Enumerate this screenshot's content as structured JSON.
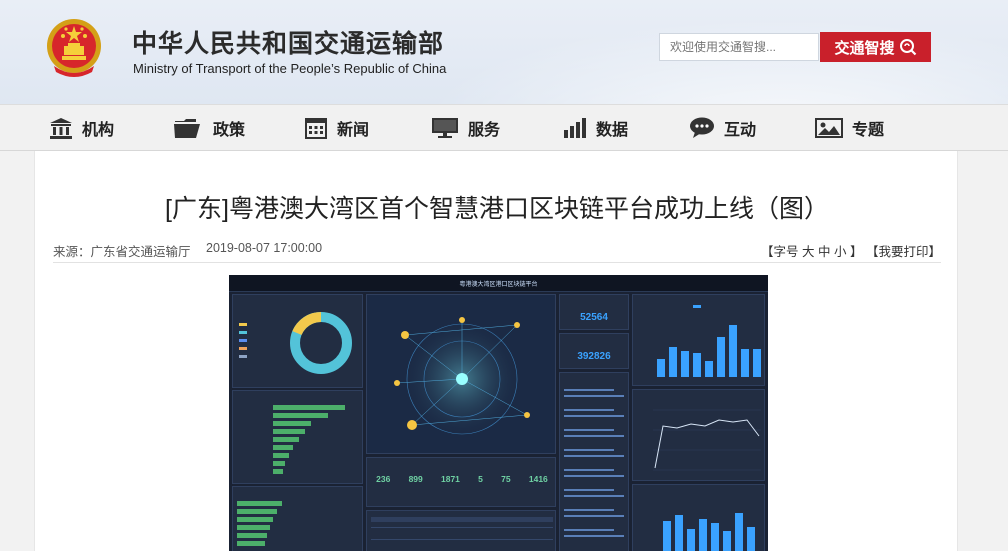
{
  "header": {
    "site_title_cn": "中华人民共和国交通运输部",
    "site_title_en": "Ministry of Transport of the People’s Republic of China",
    "search_placeholder": "欢迎使用交通智搜...",
    "search_button": "交通智搜",
    "emblem_icon": "national-emblem-icon"
  },
  "nav": [
    {
      "label": "机构",
      "icon": "building-icon"
    },
    {
      "label": "政策",
      "icon": "folder-icon"
    },
    {
      "label": "新闻",
      "icon": "calendar-grid-icon"
    },
    {
      "label": "服务",
      "icon": "monitor-icon"
    },
    {
      "label": "数据",
      "icon": "bar-chart-icon"
    },
    {
      "label": "互动",
      "icon": "chat-bubble-icon"
    },
    {
      "label": "专题",
      "icon": "picture-icon"
    }
  ],
  "article": {
    "title": "[广东]粤港澳大湾区首个智慧港口区块链平台成功上线（图）",
    "source": "来源：广东省交通运输厅",
    "date": "2019-08-07 17:00:00",
    "font_size_prefix": "【字号",
    "font_large": "大",
    "font_medium": "中",
    "font_small": "小",
    "font_size_suffix": "】",
    "print_label": "【我要打印】"
  },
  "dashboard": {
    "header_title": "粤港澳大湾区港口区块链平台",
    "stat1_value": "52564",
    "stat2_value": "392826",
    "counters": [
      {
        "value": "236"
      },
      {
        "value": "899"
      },
      {
        "value": "1871"
      },
      {
        "value": "5"
      },
      {
        "value": "75"
      },
      {
        "value": "1416"
      }
    ],
    "colors": {
      "bg": "#1a2233",
      "panel": "#222d42",
      "blue": "#3aa2ff",
      "green": "#4caf6a",
      "yellow": "#f2c94c",
      "cyan": "#53c3d9"
    }
  }
}
